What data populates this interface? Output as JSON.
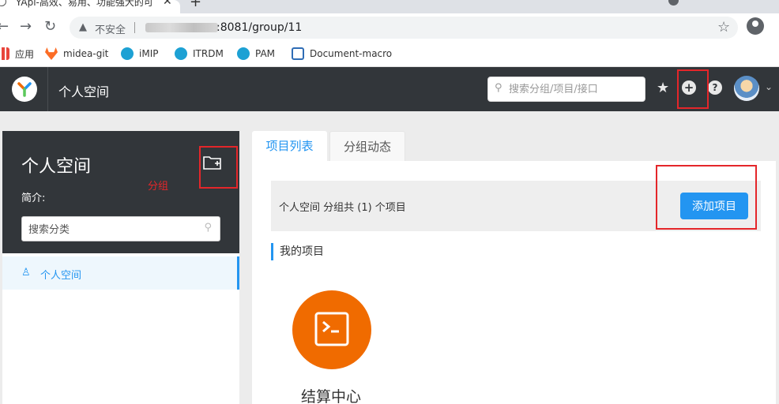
{
  "browser": {
    "tab_title": "YApi-高效、易用、功能强大的可",
    "tab_close": "✕",
    "new_tab": "+",
    "security_label": "不安全",
    "url_visible": ":8081/group/11",
    "nav_icons": [
      "back-icon",
      "forward-icon",
      "reload-icon"
    ],
    "bookmarks": [
      {
        "label": "应用",
        "icon": "apps-icon"
      },
      {
        "label": "midea-git",
        "icon": "gitlab-icon"
      },
      {
        "label": "iMIP",
        "icon": "imip-icon"
      },
      {
        "label": "ITRDM",
        "icon": "itrdm-icon"
      },
      {
        "label": "PAM",
        "icon": "pam-icon"
      },
      {
        "label": "Document-macro",
        "icon": "document-icon"
      }
    ]
  },
  "header": {
    "title": "个人空间",
    "search_placeholder": "搜索分组/项目/接口",
    "colors": {
      "bg": "#32363a",
      "accent": "#2395f1"
    }
  },
  "sidebar": {
    "group_title": "个人空间",
    "annotation": "分组",
    "intro_label": "简介:",
    "search_placeholder": "搜索分类",
    "items": [
      {
        "label": "个人空间",
        "icon": "user-icon",
        "active": true
      }
    ]
  },
  "tabs": [
    {
      "label": "项目列表",
      "active": true
    },
    {
      "label": "分组动态",
      "active": false
    }
  ],
  "main": {
    "summary_text": "个人空间 分组共 (1) 个项目",
    "add_button_label": "添加项目",
    "section_title": "我的项目",
    "projects": [
      {
        "name": "结算中心",
        "icon": "terminal-icon",
        "color": "#f06b00"
      }
    ]
  }
}
